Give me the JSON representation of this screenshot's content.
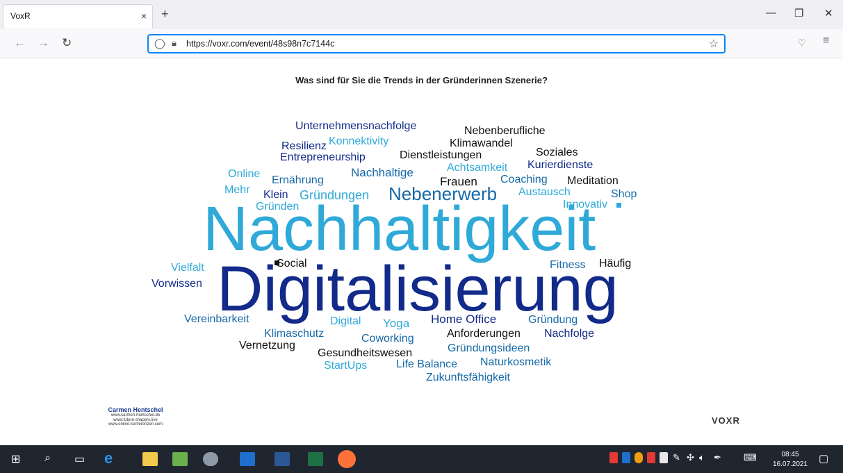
{
  "browser": {
    "tab_title": "VoxR",
    "tab_close": "×",
    "new_tab": "+",
    "url": "https://voxr.com/event/48s98n7c7144c",
    "win_min": "—",
    "win_restore": "❐",
    "win_close": "✕"
  },
  "page": {
    "question": "Was sind für Sie die Trends in der Gründerinnen Szenerie?",
    "words": {
      "unternehmensnachfolge": "Unternehmensnachfolge",
      "nebenberufliche": "Nebenberufliche",
      "konnektivity": "Konnektivity",
      "klimawandel": "Klimawandel",
      "resilienz": "Resilienz",
      "soziales": "Soziales",
      "entrepreneurship": "Entrepreneurship",
      "dienstleistungen": "Dienstleistungen",
      "achtsamkeit": "Achtsamkeit",
      "kurierdienste": "Kurierdienste",
      "online": "Online",
      "ernaehrung": "Ernährung",
      "nachhaltige": "Nachhaltige",
      "frauen": "Frauen",
      "coaching": "Coaching",
      "meditation": "Meditation",
      "mehr": "Mehr",
      "klein": "Klein",
      "gruendungen": "Gründungen",
      "nebenerwerb": "Nebenerwerb",
      "austausch": "Austausch",
      "shop": "Shop",
      "gruenden": "Gründen",
      "innovativ": "Innovativ",
      "nachhaltigkeit": "Nachhaltigkeit",
      "social": "Social",
      "vielfalt": "Vielfalt",
      "fitness": "Fitness",
      "haeufig": "Häufig",
      "vorwissen": "Vorwissen",
      "digitalisierung": "Digitalisierung",
      "vereinbarkeit": "Vereinbarkeit",
      "digital": "Digital",
      "yoga": "Yoga",
      "home_office": "Home Office",
      "gruendung": "Gründung",
      "klimaschutz": "Klimaschutz",
      "anforderungen": "Anforderungen",
      "nachfolge": "Nachfolge",
      "vernetzung": "Vernetzung",
      "coworking": "Coworking",
      "gruendungsideen": "Gründungsideen",
      "gesundheitswesen": "Gesundheitswesen",
      "naturkosmetik": "Naturkosmetik",
      "startups": "StartUps",
      "life_balance": "Life Balance",
      "zukunftsfaehigkeit": "Zukunftsfähigkeit"
    },
    "signature": {
      "name": "Carmen Hentschel",
      "line1": "www.carmen-hentschel.de",
      "line2": "www.future-shapers.live",
      "line3": "www.online-konferenzen.com"
    },
    "logo": "VOXR"
  },
  "taskbar": {
    "time": "08:45",
    "date": "16.07.2021"
  },
  "colors": {
    "dark_blue": "#1a3a8f",
    "light_blue": "#2fa9d8",
    "mid_blue": "#1669a8",
    "accent": "#0a84ff"
  }
}
